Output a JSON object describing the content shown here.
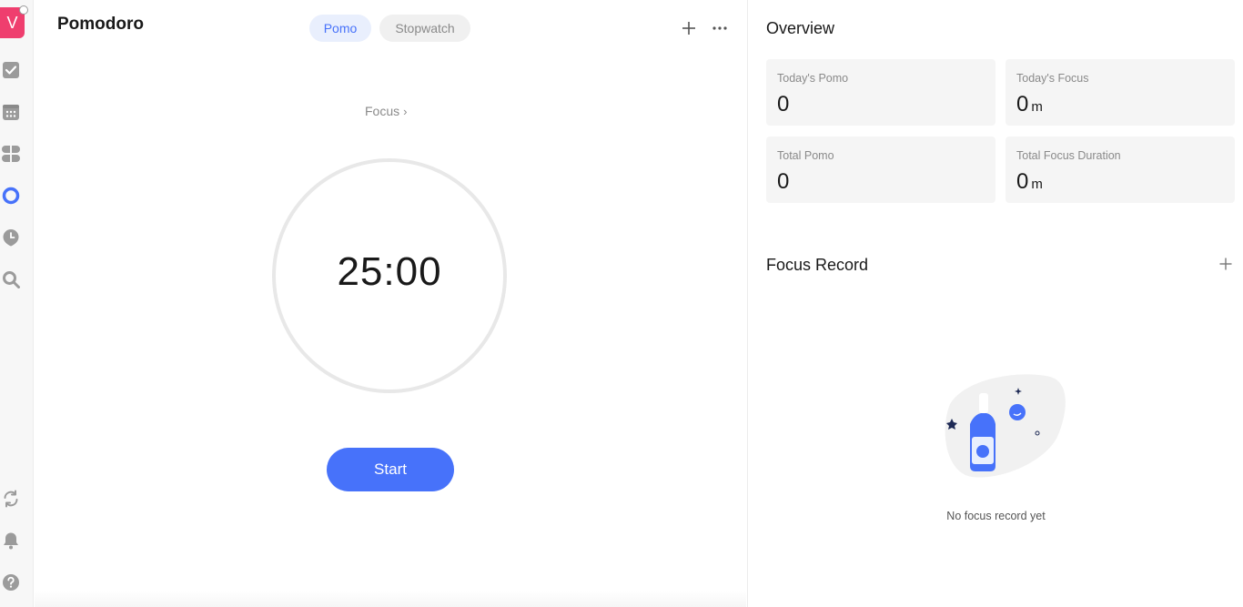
{
  "sidebar": {
    "avatar_letter": "V",
    "items": [
      {
        "name": "task-icon"
      },
      {
        "name": "calendar-icon"
      },
      {
        "name": "matrix-icon"
      },
      {
        "name": "pomodoro-icon"
      },
      {
        "name": "habit-icon"
      },
      {
        "name": "search-icon"
      },
      {
        "name": "sync-icon"
      },
      {
        "name": "notification-icon"
      },
      {
        "name": "help-icon"
      }
    ]
  },
  "main": {
    "title": "Pomodoro",
    "tabs": [
      {
        "label": "Pomo",
        "active": true
      },
      {
        "label": "Stopwatch",
        "active": false
      }
    ],
    "focus_label": "Focus",
    "timer": "25:00",
    "start_label": "Start"
  },
  "overview": {
    "title": "Overview",
    "stats": [
      {
        "label": "Today's Pomo",
        "value": "0",
        "unit": ""
      },
      {
        "label": "Today's Focus",
        "value": "0",
        "unit": "m"
      },
      {
        "label": "Total Pomo",
        "value": "0",
        "unit": ""
      },
      {
        "label": "Total Focus Duration",
        "value": "0",
        "unit": "m"
      }
    ]
  },
  "focus_record": {
    "title": "Focus Record",
    "empty_text": "No focus record yet"
  },
  "colors": {
    "accent": "#4772fa",
    "avatar": "#ef3e6e",
    "ring": "#e8e8e8"
  }
}
